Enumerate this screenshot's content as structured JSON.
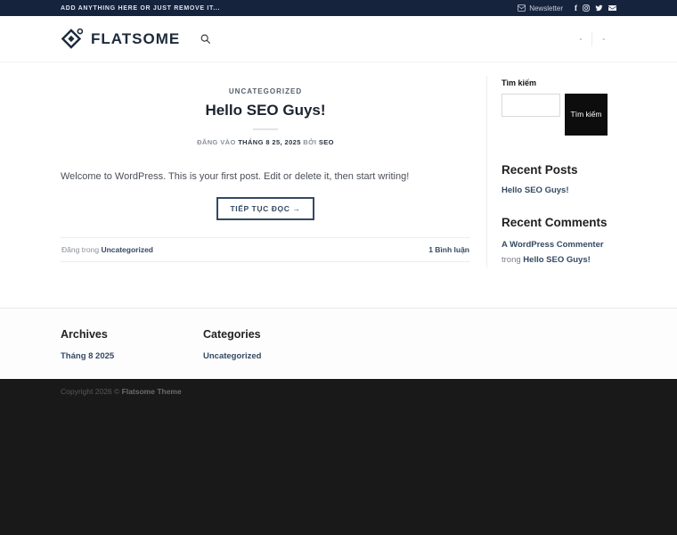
{
  "topbar": {
    "message": "ADD ANYTHING HERE OR JUST REMOVE IT...",
    "newsletter_label": "Newsletter",
    "social_icons": [
      "envelope-icon",
      "facebook-icon",
      "instagram-icon",
      "twitter-icon",
      "email-icon"
    ]
  },
  "header": {
    "logo_text": "FLATSOME",
    "search_icon": "search-icon",
    "menu": [
      {
        "label": "-"
      },
      {
        "label": "-"
      }
    ]
  },
  "post": {
    "category": "UNCATEGORIZED",
    "title": "Hello SEO Guys!",
    "meta_posted_label": "ĐĂNG VÀO",
    "meta_date": "THÁNG 8 25, 2025",
    "meta_by_label": "BỞI",
    "meta_author": "SEO",
    "excerpt": "Welcome to WordPress. This is your first post. Edit or delete it, then start writing!",
    "read_more_label": "TIẾP TỤC ĐỌC →",
    "posted_in_label": "Đăng trong",
    "posted_in_category": "Uncategorized",
    "comments_label": "1 Bình luận"
  },
  "sidebar": {
    "search": {
      "label": "Tìm kiếm",
      "button_label": "Tìm kiếm"
    },
    "recent_posts": {
      "title": "Recent Posts",
      "items": [
        {
          "label": "Hello SEO Guys!"
        }
      ]
    },
    "recent_comments": {
      "title": "Recent Comments",
      "items": [
        {
          "author": "A WordPress Commenter",
          "in_label": "trong",
          "post": "Hello SEO Guys!"
        }
      ]
    }
  },
  "footer": {
    "archives": {
      "title": "Archives",
      "items": [
        {
          "label": "Tháng 8 2025"
        }
      ]
    },
    "categories": {
      "title": "Categories",
      "items": [
        {
          "label": "Uncategorized"
        }
      ]
    },
    "copyright_prefix": "Copyright 2026 © ",
    "copyright_brand": "Flatsome Theme"
  },
  "colors": {
    "topbar_bg": "#16233d",
    "link": "#334963",
    "button_border": "#334963",
    "search_button_bg": "#0d0d0d",
    "absolute_footer_bg": "#191919"
  }
}
